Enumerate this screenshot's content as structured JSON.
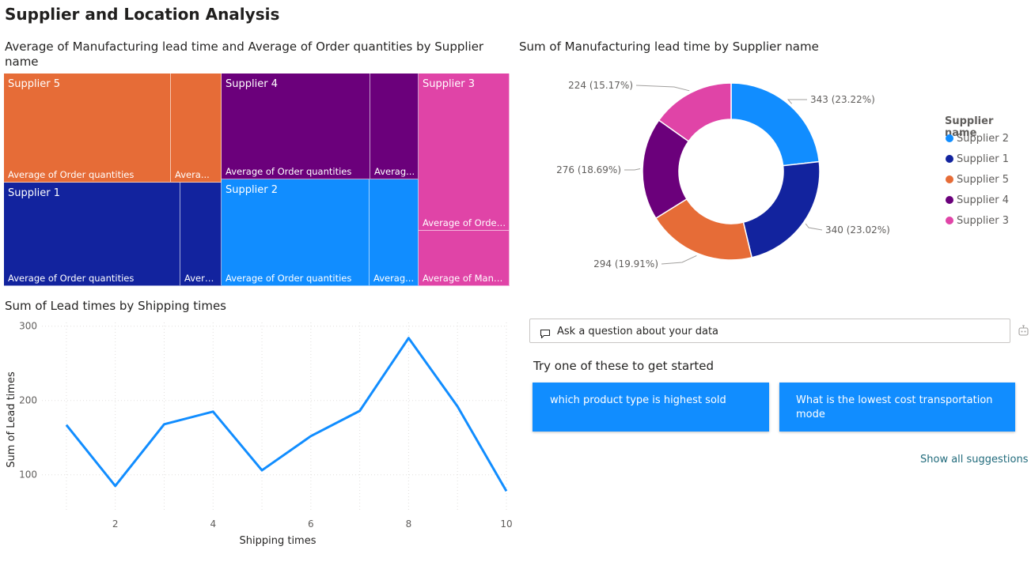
{
  "page": {
    "title": "Supplier and Location Analysis"
  },
  "treemap": {
    "title": "Average of Manufacturing lead time and Average of Order quantities by Supplier name",
    "cells": [
      {
        "supplier": "Supplier 5",
        "color": "#e66c37",
        "sub_big": "Average of Order quantities",
        "sub_small": "Avera..."
      },
      {
        "supplier": "Supplier 1",
        "color": "#12239e",
        "sub_big": "Average of Order quantities",
        "sub_small": "Avera..."
      },
      {
        "supplier": "Supplier 4",
        "color": "#6b007b",
        "sub_big": "Average of Order quantities",
        "sub_small": "Averag..."
      },
      {
        "supplier": "Supplier 2",
        "color": "#118dff",
        "sub_big": "Average of Order quantities",
        "sub_small": "Averag..."
      },
      {
        "supplier": "Supplier 3",
        "color": "#e044a7",
        "sub_big": "Average of Order...",
        "sub_small": "Average of Manu..."
      }
    ]
  },
  "donut": {
    "title": "Sum of Manufacturing lead time by Supplier name",
    "legend_title": "Supplier name",
    "chart_data": {
      "type": "pie",
      "categories": [
        "Supplier 2",
        "Supplier 1",
        "Supplier 5",
        "Supplier 4",
        "Supplier 3"
      ],
      "values": [
        343,
        340,
        294,
        276,
        224
      ],
      "labels": [
        "343 (23.22%)",
        "340 (23.02%)",
        "294 (19.91%)",
        "276 (18.69%)",
        "224 (15.17%)"
      ],
      "colors": [
        "#118dff",
        "#12239e",
        "#e66c37",
        "#6b007b",
        "#e044a7"
      ],
      "legend": "right"
    }
  },
  "linechart": {
    "title": "Sum of Lead times by Shipping times",
    "chart_data": {
      "type": "line",
      "x": [
        1,
        2,
        3,
        4,
        5,
        6,
        7,
        8,
        9,
        10
      ],
      "y": [
        167,
        85,
        168,
        185,
        106,
        152,
        186,
        284,
        192,
        78
      ],
      "xlabel": "Shipping times",
      "ylabel": "Sum of Lead times",
      "xticks": [
        "2",
        "4",
        "6",
        "8",
        "10"
      ],
      "yticks": [
        "100",
        "200",
        "300"
      ],
      "ylim": [
        55,
        305
      ],
      "xlim": [
        0.5,
        10
      ],
      "grid": true,
      "color": "#118dff"
    }
  },
  "qa": {
    "placeholder": "Ask a question about your data",
    "suggest_heading": "Try one of these to get started",
    "suggestions": [
      "which product type is highest sold",
      "What is the lowest cost transportation mode"
    ],
    "show_all": "Show all suggestions"
  }
}
